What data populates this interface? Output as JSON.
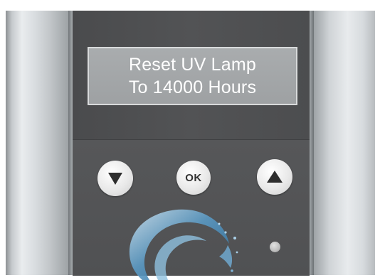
{
  "display": {
    "line1": "Reset UV Lamp",
    "line2": "To 14000 Hours"
  },
  "buttons": {
    "down": {
      "icon": "triangle-down-icon"
    },
    "ok": {
      "label": "OK"
    },
    "up": {
      "icon": "triangle-up-icon"
    }
  },
  "indicator": {
    "state": "off"
  },
  "colors": {
    "panel": "#505153",
    "lcd_background": "#a3a6a8",
    "lcd_text": "#ffffff",
    "button_face": "#eeeeee",
    "logo_water": "#5b9ac4"
  }
}
